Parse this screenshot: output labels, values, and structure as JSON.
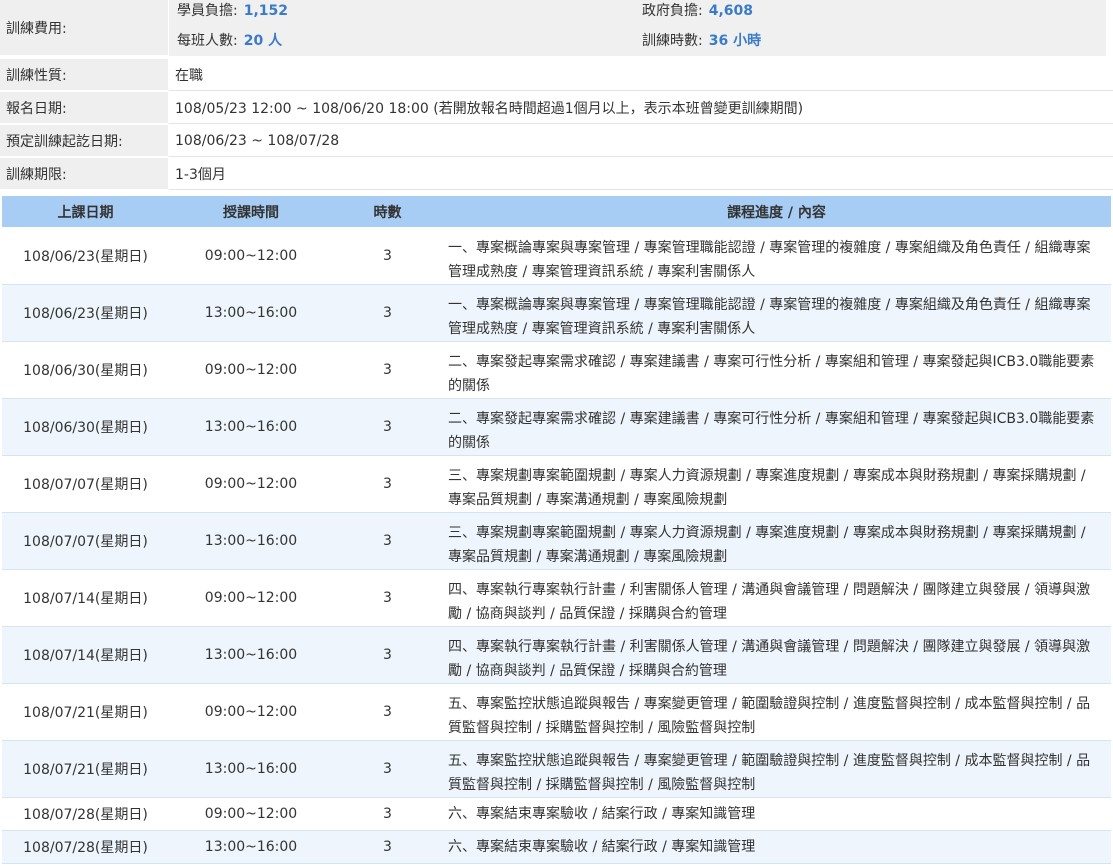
{
  "info": {
    "fee_label": "訓練費用:",
    "student_cost_label": "學員負擔:",
    "student_cost": "1,152",
    "gov_cost_label": "政府負擔:",
    "gov_cost": "4,608",
    "class_size_label": "每班人數:",
    "class_size": "20 人",
    "hours_label": "訓練時數:",
    "hours": "36 小時",
    "nature_label": "訓練性質:",
    "nature": "在職",
    "signup_label": "報名日期:",
    "signup": "108/05/23 12:00 ~ 108/06/20 18:00 (若開放報名時間超過1個月以上，表示本班曾變更訓練期間)",
    "period_label": "預定訓練起訖日期:",
    "period": "108/06/23 ~ 108/07/28",
    "duration_label": "訓練期限:",
    "duration": "1-3個月"
  },
  "schedule": {
    "headers": [
      "上課日期",
      "授課時間",
      "時數",
      "課程進度 / 內容"
    ],
    "rows": [
      {
        "date": "108/06/23(星期日)",
        "time": "09:00~12:00",
        "hours": "3",
        "content": "一、專案概論專案與專案管理 / 專案管理職能認證 / 專案管理的複雜度 / 專案組織及角色責任 / 組織專案管理成熟度 / 專案管理資訊系統 / 專案利害關係人"
      },
      {
        "date": "108/06/23(星期日)",
        "time": "13:00~16:00",
        "hours": "3",
        "content": "一、專案概論專案與專案管理 / 專案管理職能認證 / 專案管理的複雜度 / 專案組織及角色責任 / 組織專案管理成熟度 / 專案管理資訊系統 / 專案利害關係人"
      },
      {
        "date": "108/06/30(星期日)",
        "time": "09:00~12:00",
        "hours": "3",
        "content": "二、專案發起專案需求確認 / 專案建議書 / 專案可行性分析 / 專案組和管理 / 專案發起與ICB3.0職能要素的關係"
      },
      {
        "date": "108/06/30(星期日)",
        "time": "13:00~16:00",
        "hours": "3",
        "content": "二、專案發起專案需求確認 / 專案建議書 / 專案可行性分析 / 專案組和管理 / 專案發起與ICB3.0職能要素的關係"
      },
      {
        "date": "108/07/07(星期日)",
        "time": "09:00~12:00",
        "hours": "3",
        "content": "三、專案規劃專案範圍規劃 / 專案人力資源規劃 / 專案進度規劃 / 專案成本與財務規劃 / 專案採購規劃 / 專案品質規劃 / 專案溝通規劃 / 專案風險規劃"
      },
      {
        "date": "108/07/07(星期日)",
        "time": "13:00~16:00",
        "hours": "3",
        "content": "三、專案規劃專案範圍規劃 / 專案人力資源規劃 / 專案進度規劃 / 專案成本與財務規劃 / 專案採購規劃 / 專案品質規劃 / 專案溝通規劃 / 專案風險規劃"
      },
      {
        "date": "108/07/14(星期日)",
        "time": "09:00~12:00",
        "hours": "3",
        "content": "四、專案執行專案執行計畫 / 利害關係人管理 / 溝通與會議管理 / 問題解決 / 團隊建立與發展 / 領導與激勵 / 協商與談判 / 品質保證 / 採購與合約管理"
      },
      {
        "date": "108/07/14(星期日)",
        "time": "13:00~16:00",
        "hours": "3",
        "content": "四、專案執行專案執行計畫 / 利害關係人管理 / 溝通與會議管理 / 問題解決 / 團隊建立與發展 / 領導與激勵 / 協商與談判 / 品質保證 / 採購與合約管理"
      },
      {
        "date": "108/07/21(星期日)",
        "time": "09:00~12:00",
        "hours": "3",
        "content": "五、專案監控狀態追蹤與報告 / 專案變更管理 / 範圍驗證與控制 / 進度監督與控制 / 成本監督與控制 / 品質監督與控制 / 採購監督與控制 / 風險監督與控制"
      },
      {
        "date": "108/07/21(星期日)",
        "time": "13:00~16:00",
        "hours": "3",
        "content": "五、專案監控狀態追蹤與報告 / 專案變更管理 / 範圍驗證與控制 / 進度監督與控制 / 成本監督與控制 / 品質監督與控制 / 採購監督與控制 / 風險監督與控制"
      },
      {
        "date": "108/07/28(星期日)",
        "time": "09:00~12:00",
        "hours": "3",
        "content": "六、專案結束專案驗收 / 結案行政 / 專案知識管理"
      },
      {
        "date": "108/07/28(星期日)",
        "time": "13:00~16:00",
        "hours": "3",
        "content": "六、專案結束專案驗收 / 結案行政 / 專案知識管理"
      }
    ]
  }
}
